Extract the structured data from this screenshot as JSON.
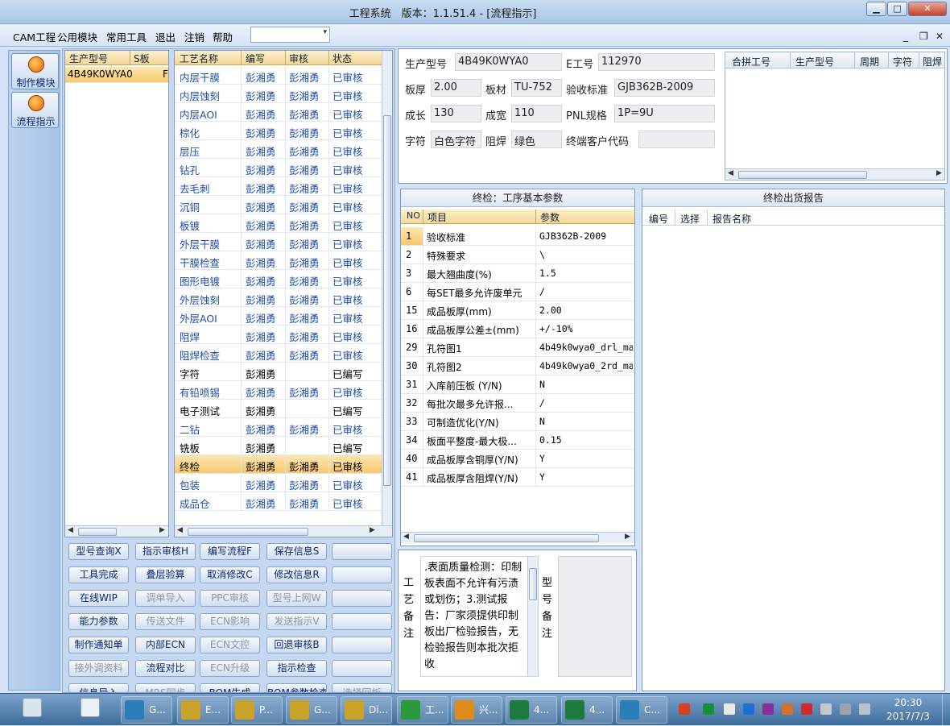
{
  "window": {
    "title": "工程系统　版本：1.1.51.4 - [流程指示]",
    "min": "▁",
    "max": "□",
    "close": "✕"
  },
  "menu": {
    "items": [
      "CAM工程",
      "公用模块",
      "常用工具",
      "退出",
      "注销",
      "帮助"
    ],
    "combo_arrow": "▾",
    "mdi_min": "_",
    "mdi_restore": "❐",
    "mdi_close": "✕"
  },
  "sidebar": {
    "buttons": [
      {
        "label": "制作模块"
      },
      {
        "label": "流程指示"
      }
    ]
  },
  "model_list": {
    "headers": [
      "生产型号",
      "S板"
    ],
    "rows": [
      {
        "model": "4B49K0WYA0",
        "s": "F"
      }
    ]
  },
  "process_list": {
    "headers": [
      "工艺名称",
      "编写",
      "审核",
      "状态"
    ],
    "rows": [
      {
        "name": "内层干膜",
        "writer": "彭湘勇",
        "reviewer": "彭湘勇",
        "status": "已审核"
      },
      {
        "name": "内层蚀刻",
        "writer": "彭湘勇",
        "reviewer": "彭湘勇",
        "status": "已审核"
      },
      {
        "name": "内层AOI",
        "writer": "彭湘勇",
        "reviewer": "彭湘勇",
        "status": "已审核"
      },
      {
        "name": "棕化",
        "writer": "彭湘勇",
        "reviewer": "彭湘勇",
        "status": "已审核"
      },
      {
        "name": "层压",
        "writer": "彭湘勇",
        "reviewer": "彭湘勇",
        "status": "已审核"
      },
      {
        "name": "钻孔",
        "writer": "彭湘勇",
        "reviewer": "彭湘勇",
        "status": "已审核"
      },
      {
        "name": "去毛刺",
        "writer": "彭湘勇",
        "reviewer": "彭湘勇",
        "status": "已审核"
      },
      {
        "name": "沉铜",
        "writer": "彭湘勇",
        "reviewer": "彭湘勇",
        "status": "已审核"
      },
      {
        "name": "板镀",
        "writer": "彭湘勇",
        "reviewer": "彭湘勇",
        "status": "已审核"
      },
      {
        "name": "外层干膜",
        "writer": "彭湘勇",
        "reviewer": "彭湘勇",
        "status": "已审核"
      },
      {
        "name": "干膜检查",
        "writer": "彭湘勇",
        "reviewer": "彭湘勇",
        "status": "已审核"
      },
      {
        "name": "图形电镀",
        "writer": "彭湘勇",
        "reviewer": "彭湘勇",
        "status": "已审核"
      },
      {
        "name": "外层蚀刻",
        "writer": "彭湘勇",
        "reviewer": "彭湘勇",
        "status": "已审核"
      },
      {
        "name": "外层AOI",
        "writer": "彭湘勇",
        "reviewer": "彭湘勇",
        "status": "已审核"
      },
      {
        "name": "阻焊",
        "writer": "彭湘勇",
        "reviewer": "彭湘勇",
        "status": "已审核"
      },
      {
        "name": "阻焊检查",
        "writer": "彭湘勇",
        "reviewer": "彭湘勇",
        "status": "已审核"
      },
      {
        "name": "字符",
        "writer": "彭湘勇",
        "reviewer": "",
        "status": "已编写"
      },
      {
        "name": "有铅喷锡",
        "writer": "彭湘勇",
        "reviewer": "彭湘勇",
        "status": "已审核"
      },
      {
        "name": "电子测试",
        "writer": "彭湘勇",
        "reviewer": "",
        "status": "已编写"
      },
      {
        "name": "二钻",
        "writer": "彭湘勇",
        "reviewer": "彭湘勇",
        "status": "已审核"
      },
      {
        "name": "铣板",
        "writer": "彭湘勇",
        "reviewer": "",
        "status": "已编写"
      },
      {
        "name": "终检",
        "writer": "彭湘勇",
        "reviewer": "彭湘勇",
        "status": "已审核"
      },
      {
        "name": "包装",
        "writer": "彭湘勇",
        "reviewer": "彭湘勇",
        "status": "已审核"
      },
      {
        "name": "成品仓",
        "writer": "彭湘勇",
        "reviewer": "彭湘勇",
        "status": "已审核"
      }
    ]
  },
  "buttons": [
    [
      "型号查询X",
      "指示审核H",
      "编写流程F",
      "保存信息S",
      ""
    ],
    [
      "工具完成",
      "叠层验算",
      "取消修改C",
      "修改信息R",
      ""
    ],
    [
      "在线WIP",
      "调单导入",
      "PPC审核",
      "型号上网W",
      ""
    ],
    [
      "能力参数",
      "传送文件",
      "ECN影响",
      "发送指示V",
      ""
    ],
    [
      "制作通知单",
      "内部ECN",
      "ECN文控",
      "回退审核B",
      ""
    ],
    [
      "接外调资料",
      "流程对比",
      "ECN升级",
      "指示检查",
      ""
    ],
    [
      "信息导入",
      "MRS同步",
      "BOM生成",
      "BOM参数检查",
      "选择回板"
    ]
  ],
  "disabled_buttons": [
    "调单导入",
    "PPC审核",
    "型号上网W",
    "传送文件",
    "ECN影响",
    "发送指示V",
    "ECN文控",
    "ECN升级",
    "接外调资料",
    "MRS同步",
    "选择回板"
  ],
  "info": {
    "model_label": "生产型号",
    "model_value": "4B49K0WYA0",
    "eno_label": "E工号",
    "eno_value": "112970",
    "thick_label": "板厚",
    "thick_value": "2.00",
    "mat_label": "板材",
    "mat_value": "TU-752",
    "std_label": "验收标准",
    "std_value": "GJB362B-2009",
    "len_label": "成长",
    "len_value": "130",
    "wid_label": "成宽",
    "wid_value": "110",
    "pnl_label": "PNL规格",
    "pnl_value": "1P=9U",
    "char_label": "字符",
    "char_value": "白色字符",
    "mask_label": "阻焊",
    "mask_value": "绿色",
    "cust_label": "终端客户代码",
    "cust_value": ""
  },
  "merge_table": {
    "headers": [
      "合拼工号",
      "生产型号",
      "周期",
      "字符",
      "阻焊"
    ]
  },
  "params": {
    "title": "终检：工序基本参数",
    "headers": [
      "NO",
      "项目",
      "参数"
    ],
    "rows": [
      {
        "no": "1",
        "item": "验收标准",
        "val": "GJB362B-2009"
      },
      {
        "no": "2",
        "item": "特殊要求",
        "val": "\\"
      },
      {
        "no": "3",
        "item": "最大翘曲度(%)",
        "val": "1.5"
      },
      {
        "no": "6",
        "item": "每SET最多允许废单元",
        "val": "/"
      },
      {
        "no": "15",
        "item": "成品板厚(mm)",
        "val": "2.00"
      },
      {
        "no": "16",
        "item": "成品板厚公差±(mm)",
        "val": "+/-10%"
      },
      {
        "no": "29",
        "item": "孔符图1",
        "val": "4b49k0wya0_drl_ma"
      },
      {
        "no": "30",
        "item": "孔符图2",
        "val": "4b49k0wya0_2rd_ma"
      },
      {
        "no": "31",
        "item": "入库前压板 (Y/N)",
        "val": "N"
      },
      {
        "no": "32",
        "item": "每批次最多允许报...",
        "val": "/"
      },
      {
        "no": "33",
        "item": "可制造优化(Y/N)",
        "val": "N"
      },
      {
        "no": "34",
        "item": "板面平整度-最大极...",
        "val": "0.15"
      },
      {
        "no": "40",
        "item": "成品板厚含铜厚(Y/N)",
        "val": "Y"
      },
      {
        "no": "41",
        "item": "成品板厚含阻焊(Y/N)",
        "val": "Y"
      }
    ]
  },
  "report": {
    "title": "终检出货报告",
    "headers": [
      "编号",
      "选择",
      "报告名称"
    ]
  },
  "remarks": {
    "process_label": "工艺备注",
    "process_text": ".表面质量检测：印制板表面不允许有污渍或划伤；3.测试报告：厂家须提供印制板出厂检验报告，无检验报告则本批次拒收",
    "model_label": "型号备注"
  },
  "taskbar": {
    "items": [
      "G...",
      "E...",
      "P...",
      "G...",
      "Di...",
      "工...",
      "兴...",
      "4...",
      "4...",
      "C..."
    ],
    "time": "20:30",
    "date": "2017/7/3"
  },
  "colors": {
    "accent": "#f8c86e",
    "header": "#f3d89a",
    "link": "#1f4fa8"
  }
}
